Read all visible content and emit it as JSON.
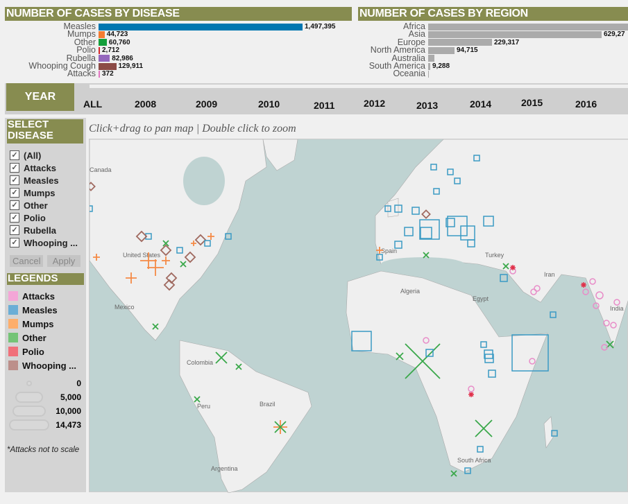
{
  "disease_chart": {
    "title": "NUMBER OF CASES BY DISEASE",
    "rows": [
      {
        "label": "Measles",
        "value": 1497395,
        "display": "1,497,395",
        "color": "#0076b0"
      },
      {
        "label": "Mumps",
        "value": 44723,
        "display": "44,723",
        "color": "#f57c32"
      },
      {
        "label": "Other",
        "value": 60760,
        "display": "60,760",
        "color": "#14a03c"
      },
      {
        "label": "Polio",
        "value": 2712,
        "display": "2,712",
        "color": "#d62728"
      },
      {
        "label": "Rubella",
        "value": 82986,
        "display": "82,986",
        "color": "#9467bd"
      },
      {
        "label": "Whooping Cough",
        "value": 129911,
        "display": "129,911",
        "color": "#8c4b46"
      },
      {
        "label": "Attacks",
        "value": 372,
        "display": "372",
        "color": "#e377c2"
      }
    ]
  },
  "region_chart": {
    "title": "NUMBER OF CASES BY REGION",
    "rows": [
      {
        "label": "Africa",
        "display": ""
      },
      {
        "label": "Asia",
        "display": "629,27"
      },
      {
        "label": "Europe",
        "display": "229,317"
      },
      {
        "label": "North America",
        "display": "94,715"
      },
      {
        "label": "Australia",
        "display": ""
      },
      {
        "label": "South America",
        "display": "9,288"
      },
      {
        "label": "Oceania",
        "display": ""
      }
    ],
    "color": "#ababab"
  },
  "year_filter": {
    "label": "YEAR",
    "options": [
      "ALL",
      "2008",
      "2009",
      "2010",
      "2011",
      "2012",
      "2013",
      "2014",
      "2015",
      "2016"
    ]
  },
  "select_disease": {
    "title": "SELECT DISEASE",
    "items": [
      {
        "label": "(All)",
        "checked": true
      },
      {
        "label": "Attacks",
        "checked": true
      },
      {
        "label": "Measles",
        "checked": true
      },
      {
        "label": "Mumps",
        "checked": true
      },
      {
        "label": "Other",
        "checked": true
      },
      {
        "label": "Polio",
        "checked": true
      },
      {
        "label": "Rubella",
        "checked": true
      },
      {
        "label": "Whooping ...",
        "checked": true
      }
    ],
    "cancel": "Cancel",
    "apply": "Apply"
  },
  "legends": {
    "title": "LEGENDS",
    "items": [
      {
        "label": "Attacks",
        "color": "#f4a6d7"
      },
      {
        "label": "Measles",
        "color": "#6baed6"
      },
      {
        "label": "Mumps",
        "color": "#fdae6b"
      },
      {
        "label": "Other",
        "color": "#74c476"
      },
      {
        "label": "Polio",
        "color": "#f0707a"
      },
      {
        "label": "Whooping ...",
        "color": "#bc8f8a"
      }
    ],
    "sizes": [
      "0",
      "5,000",
      "10,000",
      "14,473"
    ],
    "note": "*Attacks not to scale"
  },
  "map": {
    "hint": "Click+drag to pan map | Double click to zoom",
    "labels": [
      "Canada",
      "United States",
      "Mexico",
      "Colombia",
      "Peru",
      "Brazil",
      "Argentina",
      "Spain",
      "Algeria",
      "Egypt",
      "Turkey",
      "Iran",
      "India",
      "South Africa"
    ],
    "ocean_color": "#bfd3d2",
    "land_color": "#efefef"
  }
}
